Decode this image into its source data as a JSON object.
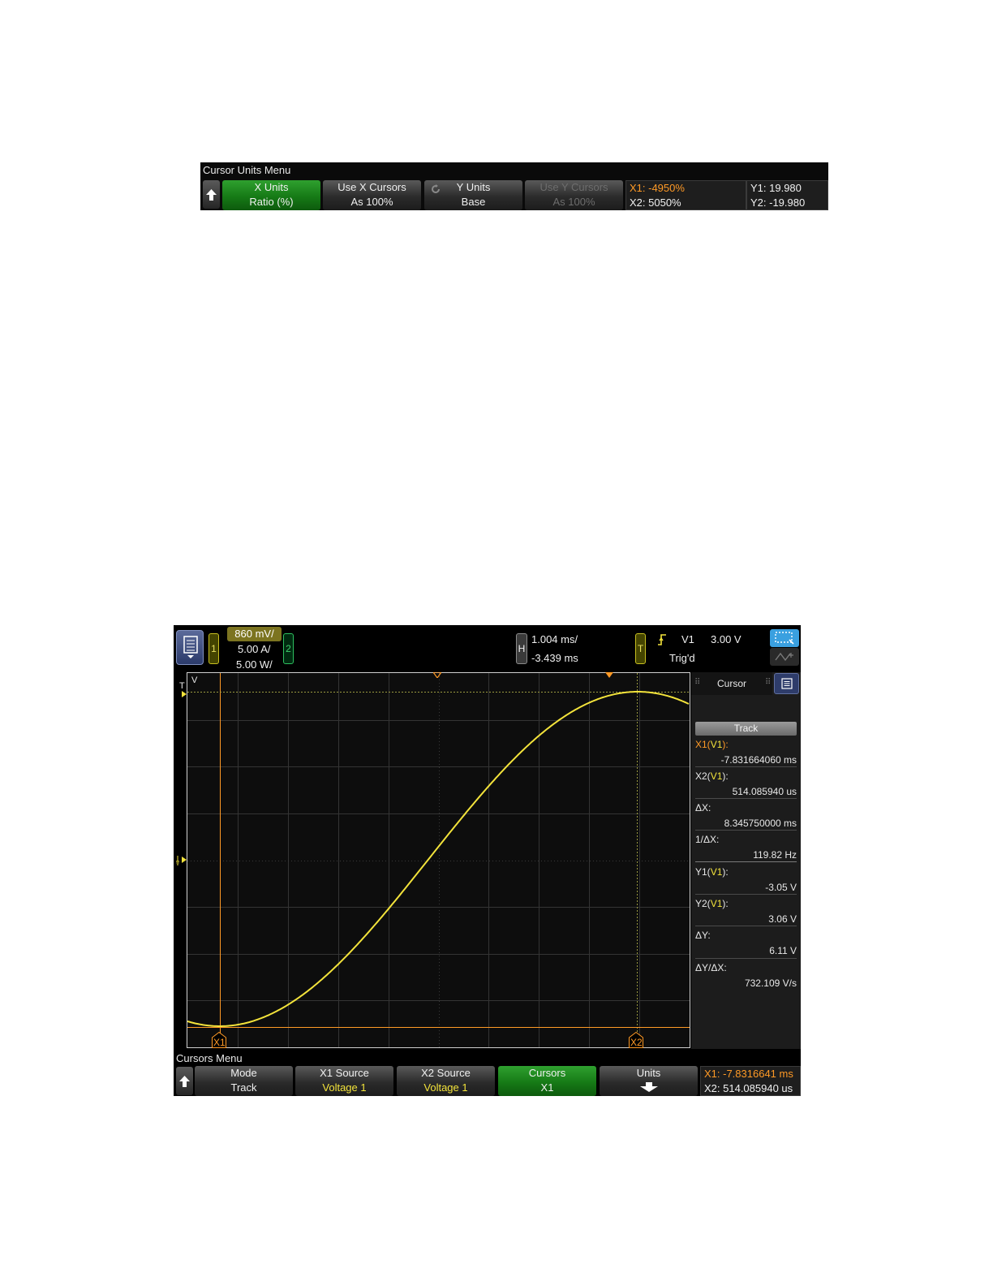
{
  "units_menu": {
    "title": "Cursor Units Menu",
    "softkeys": [
      {
        "line1": "X Units",
        "line2": "Ratio (%)"
      },
      {
        "line1": "Use X Cursors",
        "line2": "As 100%"
      },
      {
        "line1": "Y Units",
        "line2": "Base"
      },
      {
        "line1": "Use Y Cursors",
        "line2": "As 100%"
      }
    ],
    "readout_x1": "X1:  -4950%",
    "readout_x2": "X2:  5050%",
    "readout_y1": "Y1: 19.980",
    "readout_y2": "Y2: -19.980"
  },
  "scope": {
    "header": {
      "ch1_number": "1",
      "ch1_scale": "860 mV/",
      "ch_amp_scale": "5.00 A/",
      "ch_power_scale": "5.00 W/",
      "ch2_number": "2",
      "horiz_badge": "H",
      "time_per_div": "1.004 ms/",
      "time_delay": "-3.439 ms",
      "trig_badge": "T",
      "trig_source": "V1",
      "trig_level": "3.00 V",
      "trig_status": "Trig'd"
    },
    "graticule": {
      "channel_label": "V",
      "trig_marker_label": "T",
      "x1_marker": "X1",
      "x2_marker": "X2"
    },
    "side_panel": {
      "title": "Cursor",
      "mode_button": "Track",
      "x1_label": "X1(",
      "x1_src": "V1",
      "x1_close": "):",
      "x1_value": "-7.831664060 ms",
      "x2_label": "X2(",
      "x2_src": "V1",
      "x2_close": "):",
      "x2_value": "514.085940 us",
      "dx_label": "ΔX:",
      "dx_value": "8.345750000 ms",
      "inv_dx_label": "1/ΔX:",
      "inv_dx_value": "119.82 Hz",
      "y1_label": "Y1(",
      "y1_src": "V1",
      "y1_close": "):",
      "y1_value": "-3.05 V",
      "y2_label": "Y2(",
      "y2_src": "V1",
      "y2_close": "):",
      "y2_value": "3.06 V",
      "dy_label": "ΔY:",
      "dy_value": "6.11 V",
      "slope_label": "ΔY/ΔX:",
      "slope_value": "732.109 V/s"
    },
    "bottom_menu": {
      "title": "Cursors Menu",
      "softkeys": [
        {
          "line1": "Mode",
          "line2": "Track"
        },
        {
          "line1": "X1 Source",
          "line2": "Voltage 1"
        },
        {
          "line1": "X2 Source",
          "line2": "Voltage 1"
        },
        {
          "line1": "Cursors",
          "line2": "X1"
        },
        {
          "line1": "Units",
          "line2": ""
        }
      ],
      "readout_x1": "X1:  -7.8316641 ms",
      "readout_x2": "X2:  514.085940 us"
    },
    "colors": {
      "trace": "#f3e33b",
      "cursor": "#ff9a26",
      "active_key": "#1a8a1a"
    }
  }
}
